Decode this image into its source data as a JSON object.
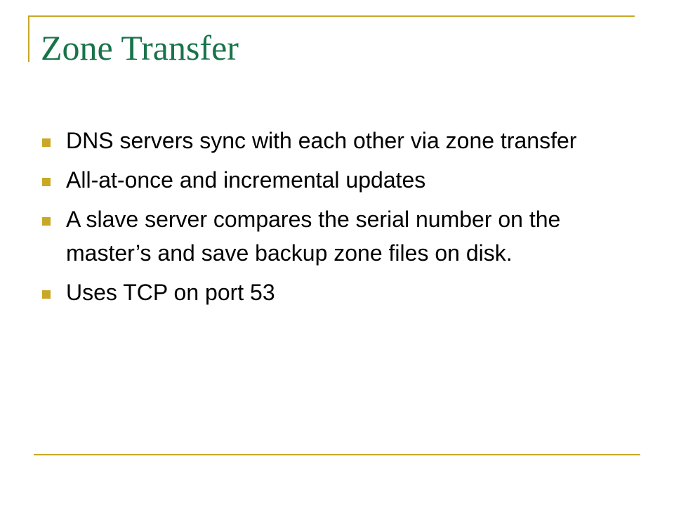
{
  "slide": {
    "title": "Zone Transfer",
    "accent_color": "#c9a826",
    "title_color": "#19734a",
    "bullets": [
      "DNS servers sync with each other via zone transfer",
      "All-at-once and incremental updates",
      "A slave server compares the serial number on the master’s and save backup zone files on disk.",
      "Uses TCP on port 53"
    ]
  }
}
